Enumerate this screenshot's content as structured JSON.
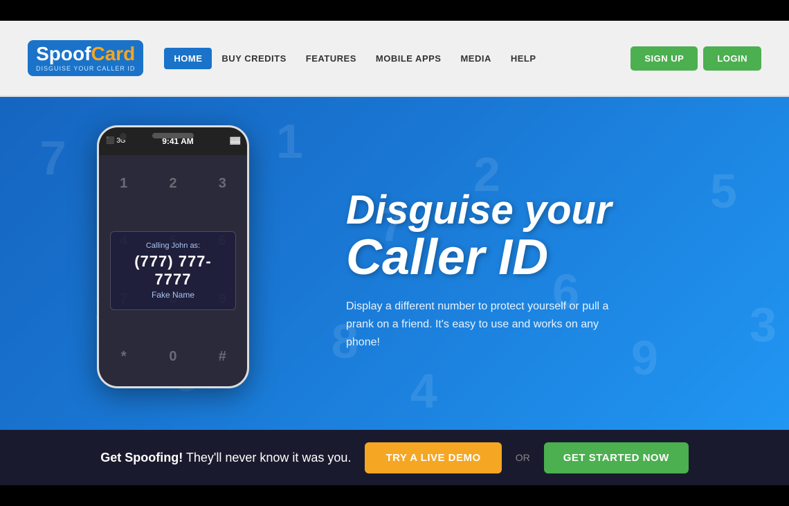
{
  "header": {
    "logo": {
      "spoof": "Spoof",
      "card": "Card",
      "tagline": "DISGUISE YOUR CALLER ID"
    },
    "nav": {
      "items": [
        {
          "label": "HOME",
          "active": true
        },
        {
          "label": "BUY CREDITS",
          "active": false
        },
        {
          "label": "FEATURES",
          "active": false
        },
        {
          "label": "MOBILE APPS",
          "active": false
        },
        {
          "label": "MEDIA",
          "active": false
        },
        {
          "label": "HELP",
          "active": false
        }
      ]
    },
    "signup_label": "SIGN UP",
    "login_label": "LOGIN"
  },
  "hero": {
    "title_line1": "Disguise your",
    "title_line2": "Caller ID",
    "description": "Display a different number to protect yourself or pull a prank on a friend. It's easy to use and works on any phone!",
    "phone": {
      "signal": "⬛ 3G",
      "time": "9:41 AM",
      "battery": "🔋",
      "calling_label": "Calling John as:",
      "calling_number": "(777) 777-7777",
      "calling_name": "Fake Name",
      "dialpad": [
        "1",
        "2",
        "3",
        "4",
        "5",
        "6",
        "7",
        "8",
        "9",
        "*",
        "0",
        "#"
      ]
    }
  },
  "cta_bar": {
    "text_prefix": "Get Spoofing!",
    "text_suffix": " They'll never know it was you.",
    "demo_label": "TRY A LIVE DEMO",
    "or_label": "OR",
    "start_label": "GET STARTED NOW"
  }
}
